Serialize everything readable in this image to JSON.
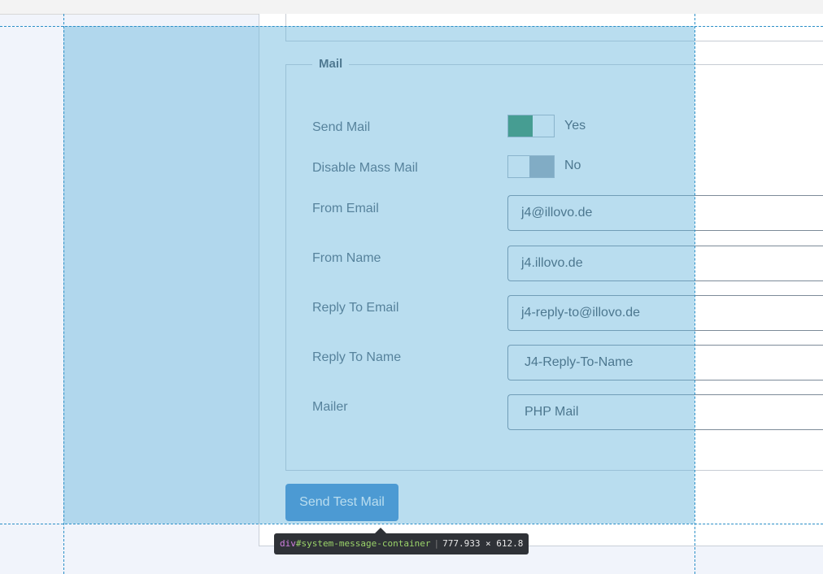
{
  "mail": {
    "legend": "Mail",
    "send_mail": {
      "label": "Send Mail",
      "state": "Yes"
    },
    "disable_mass_mail": {
      "label": "Disable Mass Mail",
      "state": "No"
    },
    "from_email": {
      "label": "From Email",
      "value": "j4@illovo.de"
    },
    "from_name": {
      "label": "From Name",
      "value": "j4.illovo.de"
    },
    "reply_to_email": {
      "label": "Reply To Email",
      "value": "j4-reply-to@illovo.de"
    },
    "reply_to_name": {
      "label": "Reply To Name",
      "value": "J4-Reply-To-Name"
    },
    "mailer": {
      "label": "Mailer",
      "value": "PHP Mail"
    }
  },
  "button": {
    "send_test": "Send Test Mail"
  },
  "inspector": {
    "tag": "div",
    "selector": "#system-message-container",
    "dimensions": "777.933 × 612.8"
  },
  "colors": {
    "overlay": "#64b4dc",
    "switch_on": "#2e8b57",
    "button": "#3a85cc"
  }
}
